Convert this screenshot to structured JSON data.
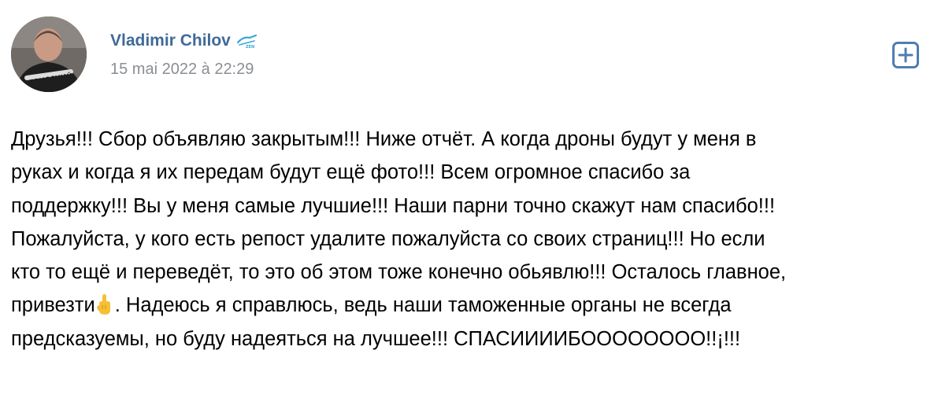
{
  "post": {
    "author": {
      "name": "Vladimir Chilov",
      "avatar_icon": "avatar-photo",
      "badge_icon": "zenit-club-logo-icon"
    },
    "date": "15 mai 2022 à 22:29",
    "add_button_icon": "plus-square-icon",
    "text_lines": [
      "Друзья!!! Сбор объявляю закрытым!!! Ниже отчёт. А когда дроны будут у меня в",
      "руках и когда я их передам будут ещё фото!!! Всем огромное спасибо за",
      "поддержку!!! Вы у меня самые лучшие!!! Наши парни точно скажут нам спасибо!!!",
      "Пожалуйста, у кого есть репост удалите пожалуйста со своих страниц!!! Но если",
      "кто то ещё и переведёт, то это об этом тоже конечно обьявлю!!! Осталось главное,",
      "привезти",
      ". Надеюсь я справлюсь, ведь наши таможенные органы не всегда",
      "предсказуемы, но буду надеяться на лучшее!!! СПАСИИИИБОООООООО!!¡!!!"
    ],
    "emoji_icon": "pointing-up-hand-emoji-icon"
  },
  "colors": {
    "author": "#3f6a99",
    "date": "#8a8e93",
    "button": "#4f7db0",
    "text": "#000000"
  }
}
